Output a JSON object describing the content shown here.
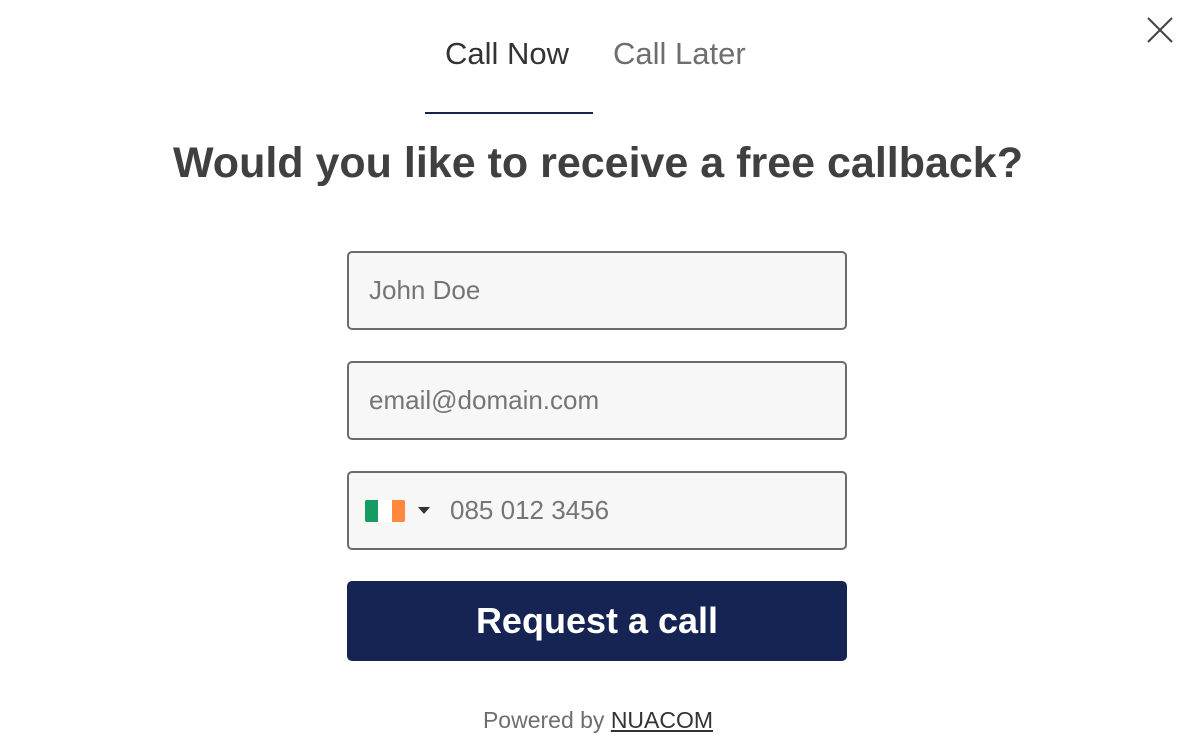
{
  "dialog": {
    "close_icon": "close-icon"
  },
  "tabs": [
    {
      "label": "Call Now",
      "active": true
    },
    {
      "label": "Call Later",
      "active": false
    }
  ],
  "headline": "Would you like to receive a free callback?",
  "form": {
    "name_placeholder": "John Doe",
    "email_placeholder": "email@domain.com",
    "phone": {
      "country_flag_icon": "ireland-flag-icon",
      "flag_colors": [
        "#169b62",
        "#ffffff",
        "#ff883e"
      ],
      "placeholder": "085 012 3456"
    },
    "submit_label": "Request a call"
  },
  "footer": {
    "prefix": "Powered by",
    "link_text": "NUACOM"
  },
  "colors": {
    "brand": "#152453",
    "field_border": "#6b6b6b",
    "field_bg": "#f7f7f7"
  }
}
